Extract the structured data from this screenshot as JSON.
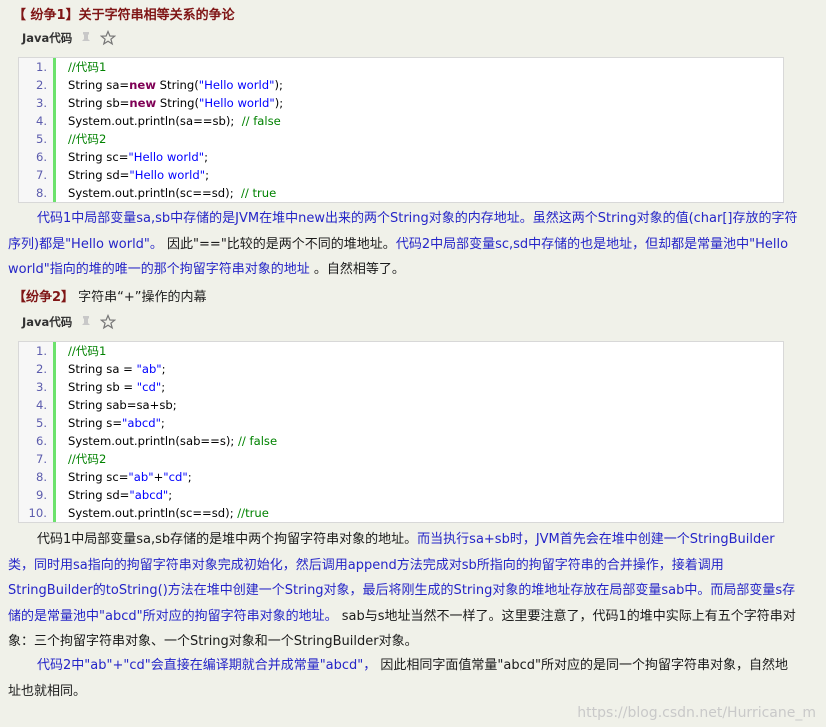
{
  "section1": {
    "title_tag": "【 纷争1】",
    "title_rest": "关于字符串相等关系的争论",
    "code_label": "Java代码",
    "lines": [
      {
        "n": "1.",
        "parts": [
          {
            "t": "//代码1",
            "k": "com"
          }
        ]
      },
      {
        "n": "2.",
        "parts": [
          {
            "t": "String sa=",
            "k": ""
          },
          {
            "t": "new",
            "k": "kw"
          },
          {
            "t": " String(",
            "k": ""
          },
          {
            "t": "\"Hello world\"",
            "k": "str"
          },
          {
            "t": ");",
            "k": ""
          }
        ]
      },
      {
        "n": "3.",
        "parts": [
          {
            "t": "String sb=",
            "k": ""
          },
          {
            "t": "new",
            "k": "kw"
          },
          {
            "t": " String(",
            "k": ""
          },
          {
            "t": "\"Hello world\"",
            "k": "str"
          },
          {
            "t": ");",
            "k": ""
          }
        ]
      },
      {
        "n": "4.",
        "parts": [
          {
            "t": "System.out.println(sa==sb);  ",
            "k": ""
          },
          {
            "t": "// false",
            "k": "com"
          }
        ]
      },
      {
        "n": "5.",
        "parts": [
          {
            "t": "//代码2",
            "k": "com"
          }
        ]
      },
      {
        "n": "6.",
        "parts": [
          {
            "t": "String sc=",
            "k": ""
          },
          {
            "t": "\"Hello world\"",
            "k": "str"
          },
          {
            "t": ";",
            "k": ""
          }
        ]
      },
      {
        "n": "7.",
        "parts": [
          {
            "t": "String sd=",
            "k": ""
          },
          {
            "t": "\"Hello world\"",
            "k": "str"
          },
          {
            "t": ";",
            "k": ""
          }
        ]
      },
      {
        "n": "8.",
        "parts": [
          {
            "t": "System.out.println(sc==sd);  ",
            "k": ""
          },
          {
            "t": "// true",
            "k": "com"
          }
        ]
      }
    ]
  },
  "para1": [
    {
      "t": "代码1中局部变量sa,sb中存储的是JVM在堆中new出来的两个String对象的内存地址。虽然这两个String对象的值(char[]存放的字符序列)都是\"Hello world\"。",
      "c": "blue"
    },
    {
      "t": " 因此\"==\"比较的是两个不同的堆地址。",
      "c": ""
    },
    {
      "t": "代码2中局部变量sc,sd中存储的也是地址，但却都是常量池中\"Hello world\"指向的堆的唯一的那个拘留字符串对象的地址",
      "c": "blue"
    },
    {
      "t": " 。自然相等了。",
      "c": ""
    }
  ],
  "section2": {
    "title_tag": "【纷争2】",
    "title_rest": " 字符串“+”操作的内幕",
    "code_label": "Java代码",
    "lines": [
      {
        "n": "1.",
        "parts": [
          {
            "t": "//代码1",
            "k": "com"
          }
        ]
      },
      {
        "n": "2.",
        "parts": [
          {
            "t": "String sa = ",
            "k": ""
          },
          {
            "t": "\"ab\"",
            "k": "str"
          },
          {
            "t": ";",
            "k": ""
          }
        ]
      },
      {
        "n": "3.",
        "parts": [
          {
            "t": "String sb = ",
            "k": ""
          },
          {
            "t": "\"cd\"",
            "k": "str"
          },
          {
            "t": ";",
            "k": ""
          }
        ]
      },
      {
        "n": "4.",
        "parts": [
          {
            "t": "String sab=sa+sb;",
            "k": ""
          }
        ]
      },
      {
        "n": "5.",
        "parts": [
          {
            "t": "String s=",
            "k": ""
          },
          {
            "t": "\"abcd\"",
            "k": "str"
          },
          {
            "t": ";",
            "k": ""
          }
        ]
      },
      {
        "n": "6.",
        "parts": [
          {
            "t": "System.out.println(sab==s); ",
            "k": ""
          },
          {
            "t": "// false",
            "k": "com"
          }
        ]
      },
      {
        "n": "7.",
        "parts": [
          {
            "t": "//代码2",
            "k": "com"
          }
        ]
      },
      {
        "n": "8.",
        "parts": [
          {
            "t": "String sc=",
            "k": ""
          },
          {
            "t": "\"ab\"",
            "k": "str"
          },
          {
            "t": "+",
            "k": ""
          },
          {
            "t": "\"cd\"",
            "k": "str"
          },
          {
            "t": ";",
            "k": ""
          }
        ]
      },
      {
        "n": "9.",
        "parts": [
          {
            "t": "String sd=",
            "k": ""
          },
          {
            "t": "\"abcd\"",
            "k": "str"
          },
          {
            "t": ";",
            "k": ""
          }
        ]
      },
      {
        "n": "10.",
        "parts": [
          {
            "t": "System.out.println(sc==sd); ",
            "k": ""
          },
          {
            "t": "//true",
            "k": "com"
          }
        ]
      }
    ]
  },
  "para2": [
    {
      "t": "代码1中局部变量sa,sb存储的是堆中两个拘留字符串对象的地址。",
      "c": ""
    },
    {
      "t": "而当执行sa+sb时，JVM首先会在堆中创建一个StringBuilder类，同时用sa指向的拘留字符串对象完成初始化，然后调用append方法完成对sb所指向的拘留字符串的合并操作，接着调用StringBuilder的toString()方法在堆中创建一个String对象，最后将刚生成的String对象的堆地址存放在局部变量sab中。而局部变量s存储的是常量池中\"abcd\"所对应的拘留字符串对象的地址。",
      "c": "blue"
    },
    {
      "t": " sab与s地址当然不一样了。这里要注意了，代码1的堆中实际上有五个字符串对象：三个拘留字符串对象、一个String对象和一个StringBuilder对象。",
      "c": ""
    }
  ],
  "para3": [
    {
      "t": "代码2中\"ab\"+\"cd\"会直接在编译期就合并成常量\"abcd\"，",
      "c": "blue"
    },
    {
      "t": " 因此相同字面值常量\"abcd\"所对应的是同一个拘留字符串对象，自然地址也就相同。",
      "c": ""
    }
  ],
  "watermark": "https://blog.csdn.net/Hurricane_m"
}
